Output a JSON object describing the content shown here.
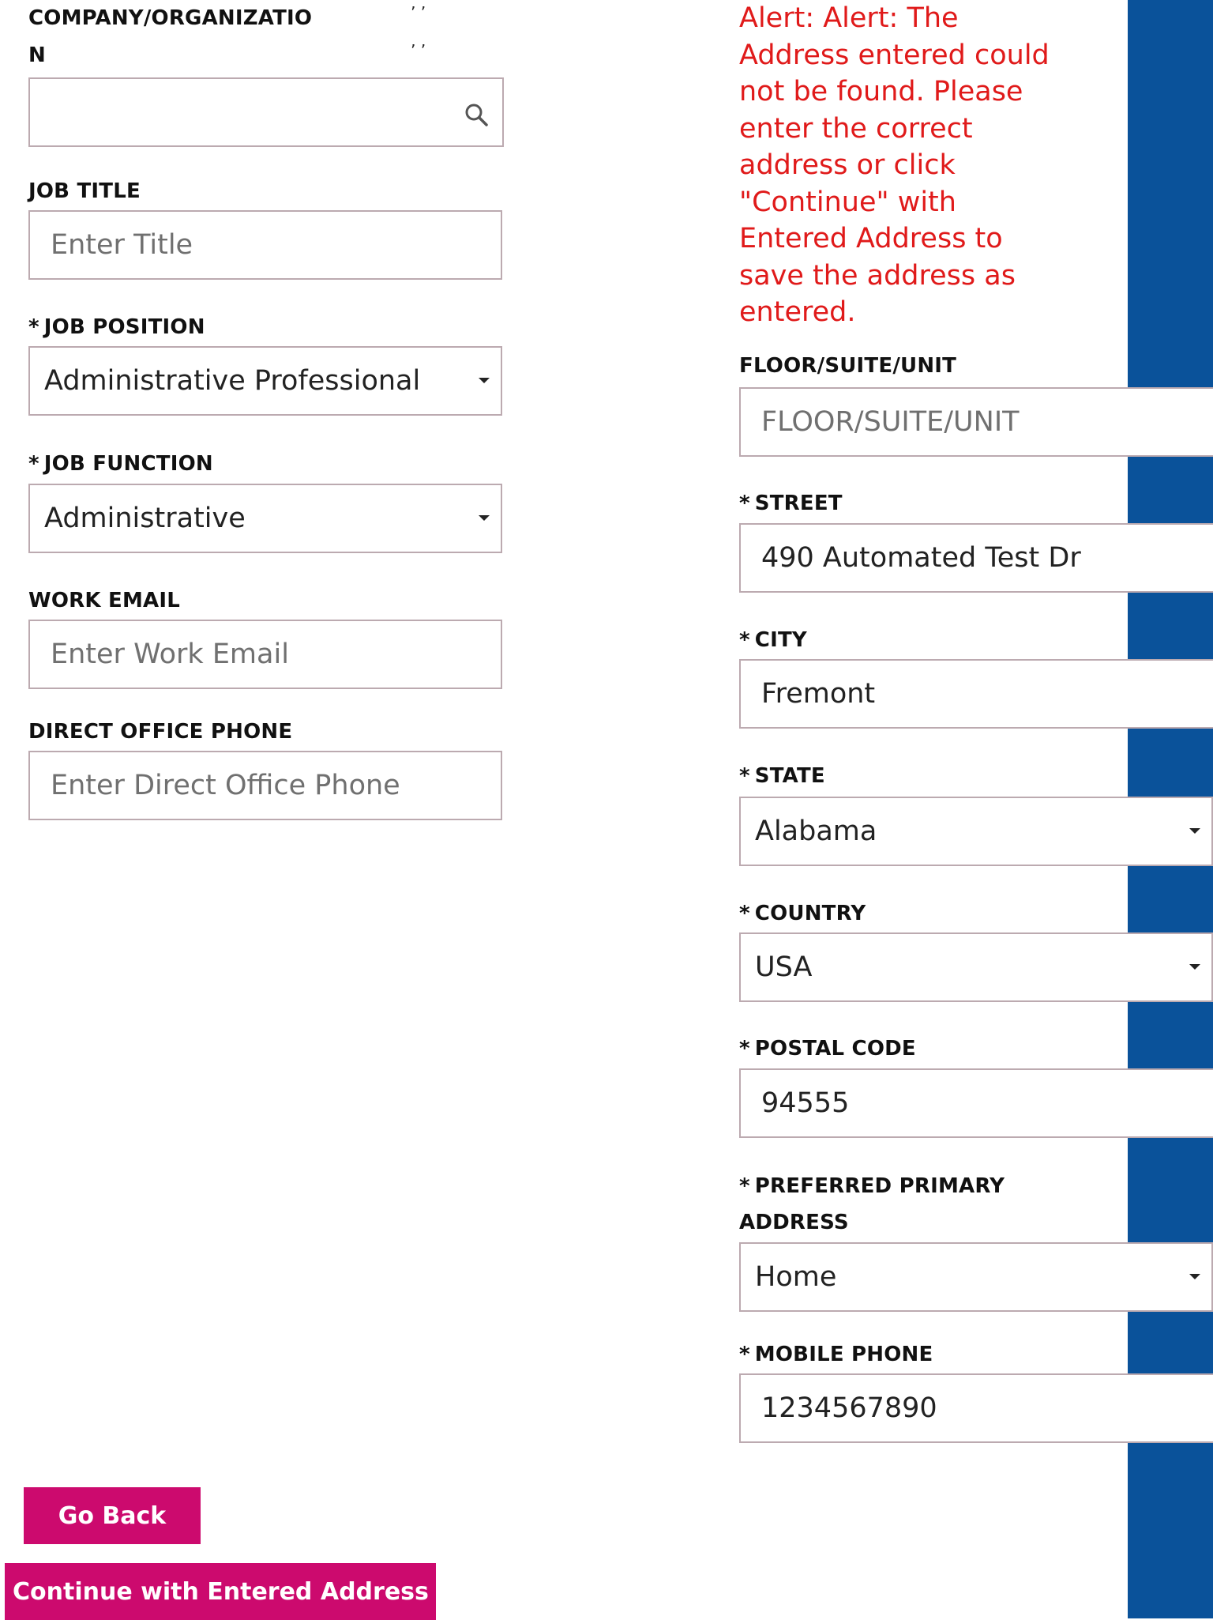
{
  "form_left": {
    "company": {
      "label_line1": "COMPANY/ORGANIZATIO",
      "label_line2": "N",
      "tick_marks": "’ ’",
      "value": ""
    },
    "job_title": {
      "label": "JOB TITLE",
      "placeholder": "Enter Title"
    },
    "job_position": {
      "required": "*",
      "label": "JOB POSITION",
      "value": "Administrative Professional"
    },
    "job_function": {
      "required": "*",
      "label": "JOB FUNCTION",
      "value": "Administrative"
    },
    "work_email": {
      "label": "WORK EMAIL",
      "placeholder": "Enter Work Email"
    },
    "direct_office_phone": {
      "label": "DIRECT OFFICE PHONE",
      "placeholder": "Enter Direct Office Phone"
    }
  },
  "form_right": {
    "alert_text": "Alert: Alert: The Address entered could not be found. Please enter the correct address or click \"Continue\" with Entered Address to save the address as entered.",
    "floor_suite_unit": {
      "label": "FLOOR/SUITE/UNIT",
      "placeholder": "FLOOR/SUITE/UNIT"
    },
    "street": {
      "required": "*",
      "label": "STREET",
      "value": "490 Automated Test Dr"
    },
    "city": {
      "required": "*",
      "label": "CITY",
      "value": "Fremont"
    },
    "state": {
      "required": "*",
      "label": "STATE",
      "value": "Alabama"
    },
    "country": {
      "required": "*",
      "label": "COUNTRY",
      "value": "USA"
    },
    "postal_code": {
      "required": "*",
      "label": "POSTAL CODE",
      "value": "94555"
    },
    "preferred_primary_address": {
      "required": "*",
      "label_line1": "PREFERRED PRIMARY",
      "label_line2": "ADDRESS",
      "value": "Home"
    },
    "mobile_phone": {
      "required": "*",
      "label": "MOBILE PHONE",
      "value": "1234567890"
    }
  },
  "buttons": {
    "go_back": "Go Back",
    "continue_entered": "Continue with Entered Address"
  },
  "icons": {
    "search": "search-icon",
    "dropdown": "caret-down-icon"
  },
  "colors": {
    "accent_band": "#0a529a",
    "button": "#cc0a6e",
    "alert": "#e01a1a",
    "field_border": "#bcaab0"
  }
}
